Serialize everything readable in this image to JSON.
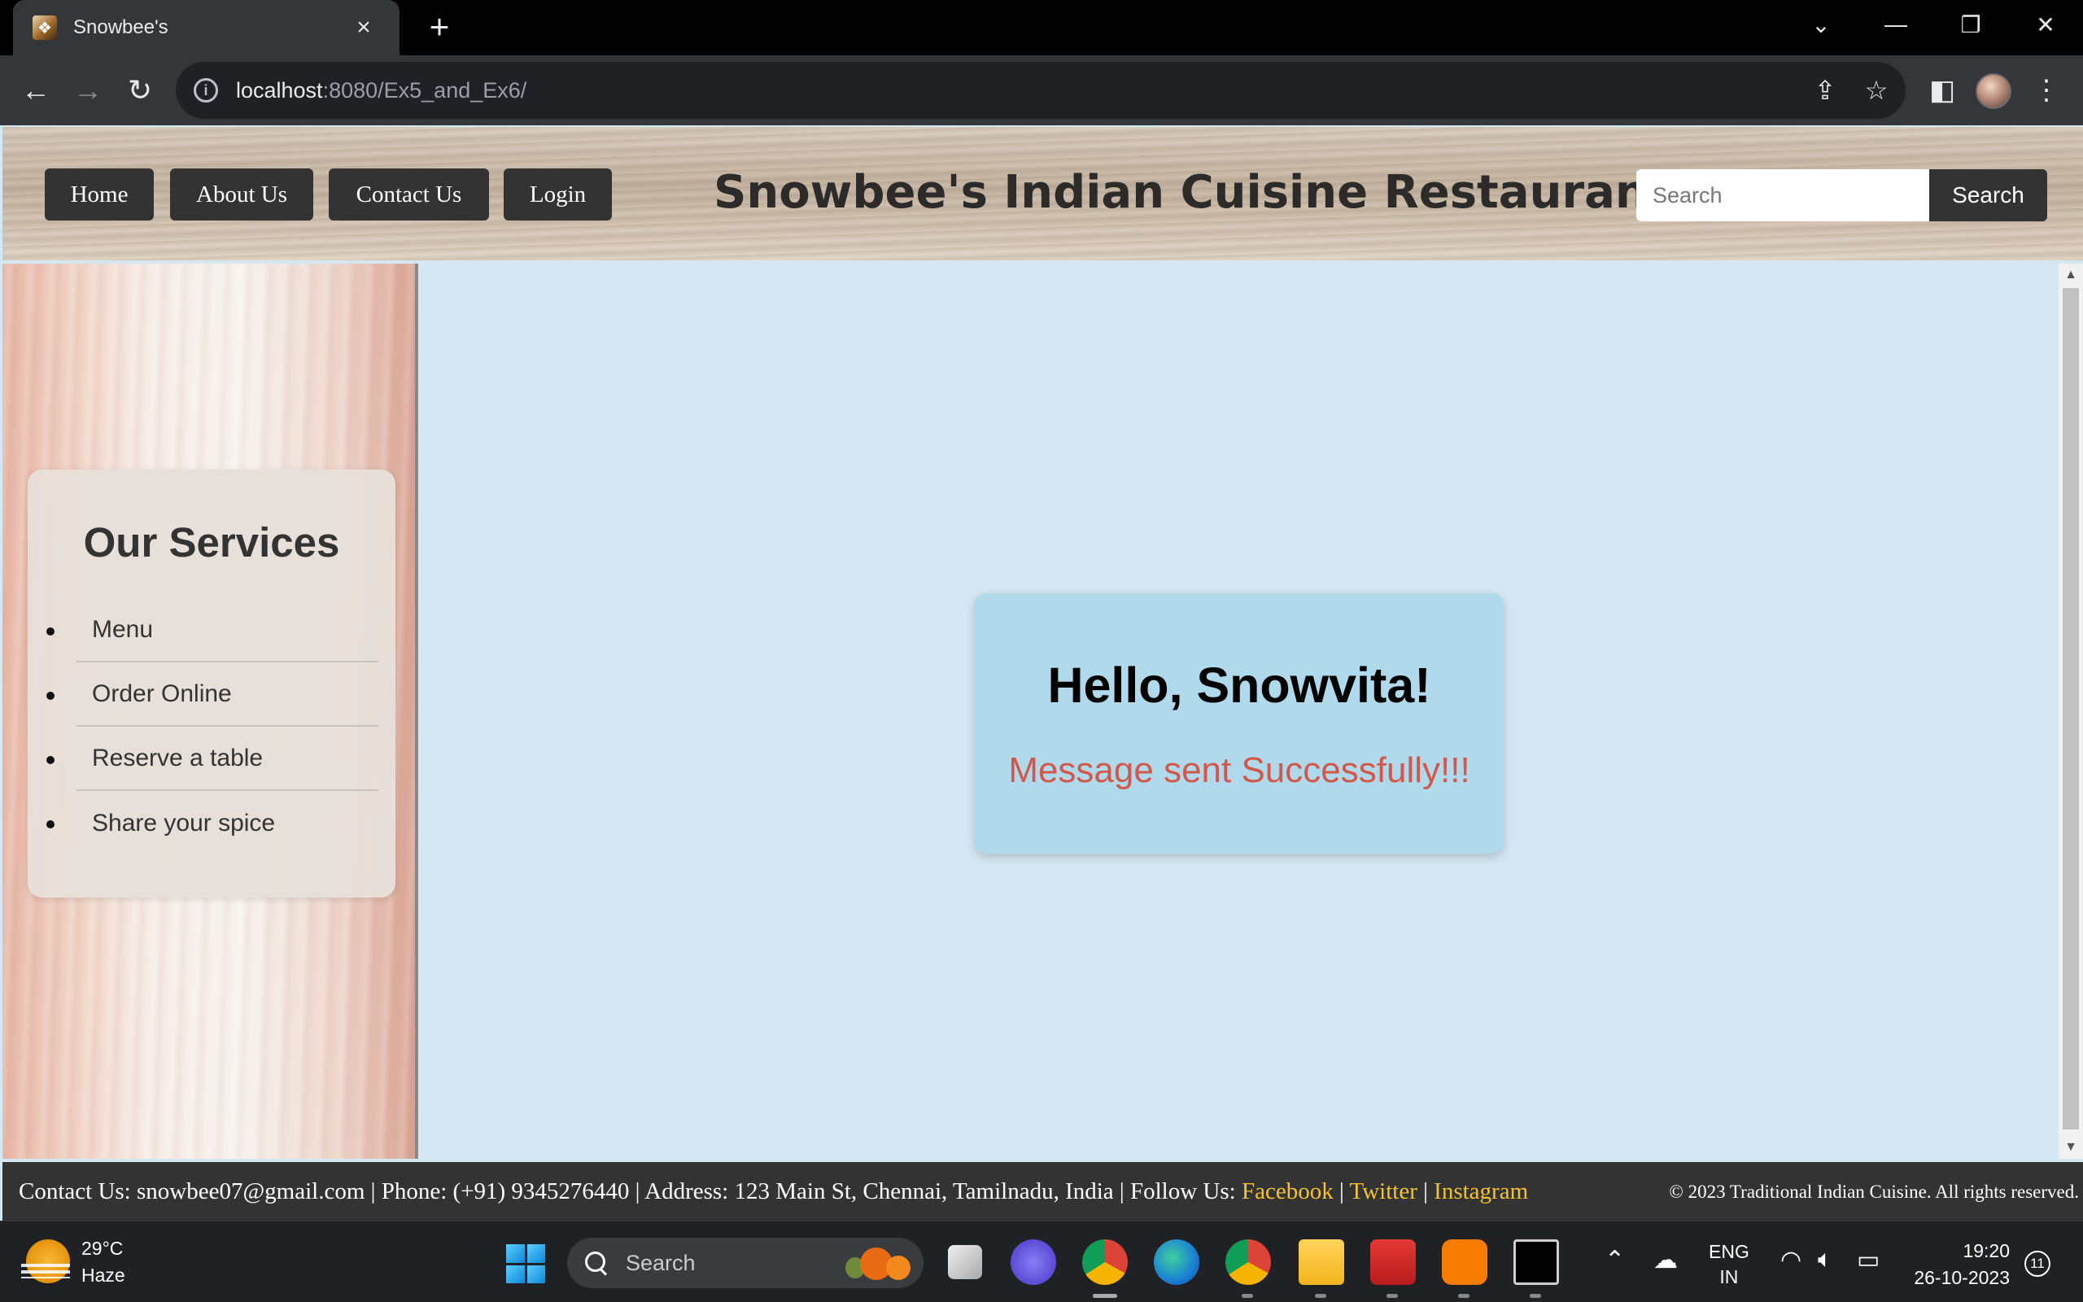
{
  "browser": {
    "tab_title": "Snowbee's",
    "new_tab_symbol": "+",
    "url_host": "localhost",
    "url_rest": ":8080/Ex5_and_Ex6/",
    "icons": [
      "back-arrow-icon",
      "forward-arrow-icon",
      "reload-icon",
      "info-icon",
      "share-icon",
      "star-icon",
      "side-panel-icon",
      "profile-avatar",
      "more-menu-icon",
      "tab-search-chevron-icon",
      "minimize-icon",
      "restore-icon",
      "close-window-icon"
    ]
  },
  "site": {
    "nav": [
      "Home",
      "About Us",
      "Contact Us",
      "Login"
    ],
    "title": "Snowbee's Indian Cuisine Restaurant",
    "search_placeholder": "Search",
    "search_button": "Search"
  },
  "sidebar": {
    "heading": "Our Services",
    "items": [
      "Menu",
      "Order Online",
      "Reserve a table",
      "Share your spice"
    ]
  },
  "main": {
    "greeting": "Hello, Snowvita!",
    "message": "Message sent Successfully!!!",
    "message_color": "#d1584a",
    "card_color": "#b0d9ec",
    "background_color": "#d5e7f2"
  },
  "footer": {
    "contact_prefix": "Contact Us: snowbee07@gmail.com | Phone: (+91) 9345276440 | Address: 123 Main St, Chennai, Tamilnadu, India | Follow Us: ",
    "links": [
      "Facebook",
      "Twitter",
      "Instagram"
    ],
    "separator": " | ",
    "copyright": "© 2023 Traditional Indian Cuisine. All rights reserved.",
    "link_color": "#f4c430"
  },
  "taskbar": {
    "weather_temp": "29°C",
    "weather_desc": "Haze",
    "search_label": "Search",
    "lang_line1": "ENG",
    "lang_line2": "IN",
    "time": "19:20",
    "date": "26-10-2023",
    "notification_count": "11"
  }
}
